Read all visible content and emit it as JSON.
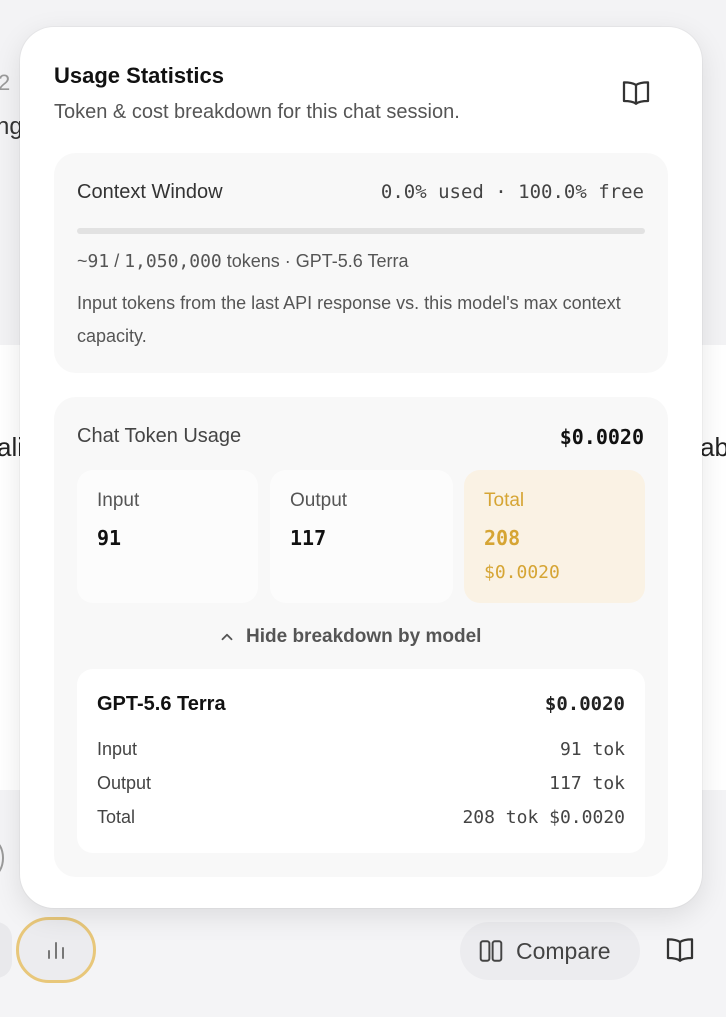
{
  "background": {
    "fragment_top_number": "2",
    "fragment_top_text": "ng",
    "fragment_left_text": "ali",
    "fragment_right_text": "ab"
  },
  "popover": {
    "title": "Usage Statistics",
    "subtitle": "Token & cost breakdown for this chat session.",
    "docs_icon": "book-icon",
    "context_window": {
      "label": "Context Window",
      "usage_summary": "0.0% used · 100.0% free",
      "used_fraction": 0.0,
      "tokens_prefix": "~",
      "tokens_used": "91",
      "tokens_sep": " / ",
      "tokens_max": "1,050,000",
      "tokens_suffix": " tokens · GPT-5.6 Terra",
      "description": "Input tokens from the last API response vs. this model's max context capacity."
    },
    "chat_usage": {
      "label": "Chat Token Usage",
      "total_cost": "$0.0020",
      "input_label": "Input",
      "input_value": "91",
      "output_label": "Output",
      "output_value": "117",
      "total_label": "Total",
      "total_value": "208",
      "total_cost_small": "$0.0020",
      "toggle_label": "Hide breakdown by model",
      "toggle_icon": "chevron-up-icon",
      "model": {
        "name": "GPT-5.6 Terra",
        "cost": "$0.0020",
        "rows": [
          {
            "label": "Input",
            "value": "91 tok"
          },
          {
            "label": "Output",
            "value": "117 tok"
          },
          {
            "label": "Total",
            "value": "208 tok $0.0020"
          }
        ]
      }
    }
  },
  "toolbar": {
    "stats_icon": "bar-chart-icon",
    "compare_label": "Compare",
    "compare_icon": "columns-icon",
    "book_icon": "book-icon"
  },
  "colors": {
    "accent": "#d6a534",
    "total_bg": "#faf2e4",
    "stats_ring": "#e8c77a"
  }
}
